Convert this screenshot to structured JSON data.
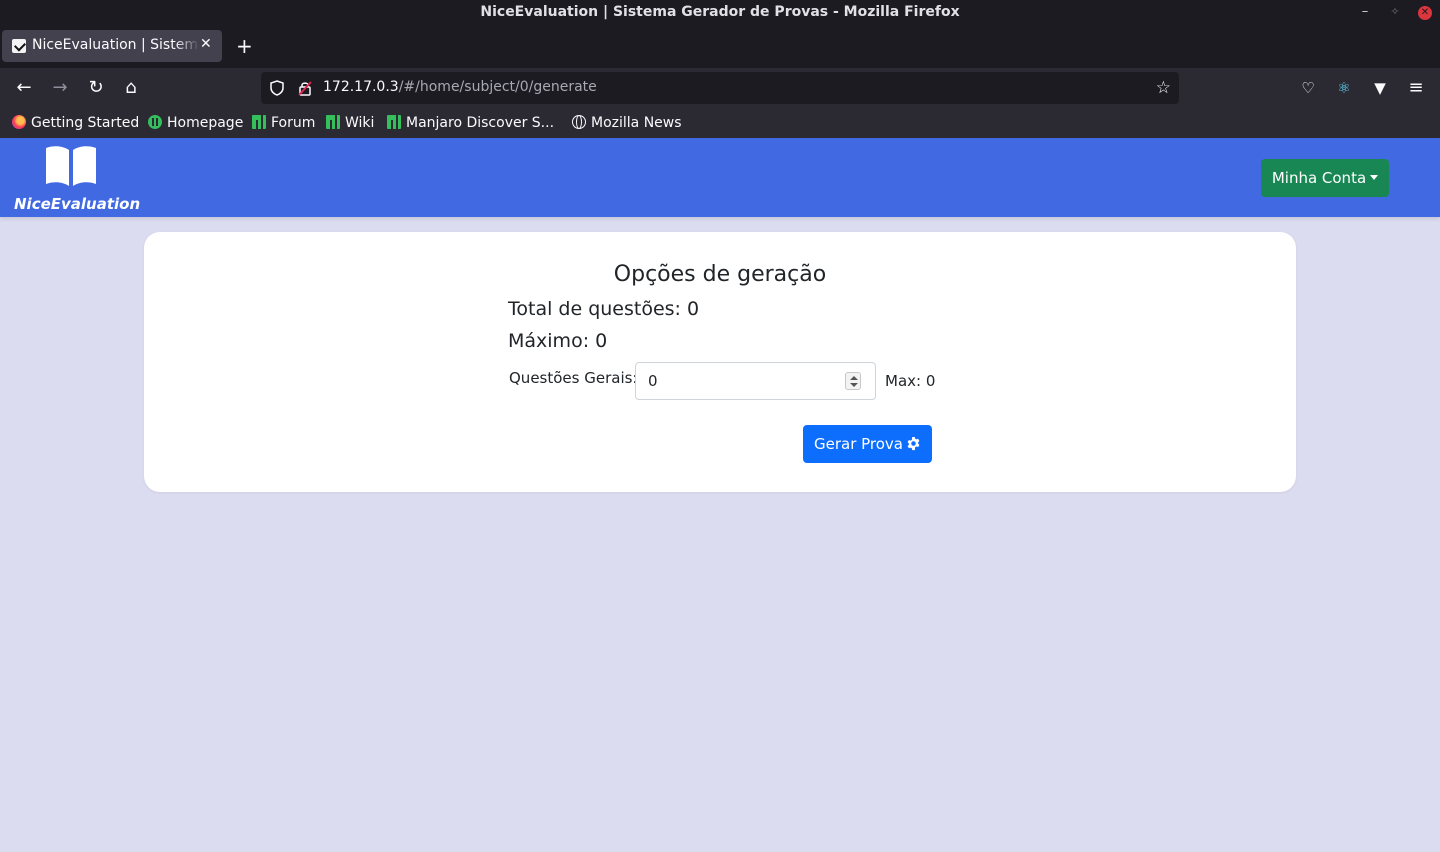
{
  "window": {
    "title": "NiceEvaluation | Sistema Gerador de Provas - Mozilla Firefox",
    "minimize": "–",
    "maximize": "✧",
    "close": "✕"
  },
  "tab": {
    "title": "NiceEvaluation | Sistema Gerador de Provas",
    "close": "✕",
    "new_tab": "+"
  },
  "nav": {
    "back": "←",
    "forward": "→",
    "reload": "↻",
    "home": "⌂",
    "url_host": "172.17.0.3",
    "url_path": "/#/home/subject/0/generate",
    "bookmark_star": "☆",
    "pocket": "♡",
    "react_devtools": "⚛",
    "vpn": "▼",
    "menu": "≡"
  },
  "bookmarks": [
    {
      "label": "Getting Started",
      "icon": "firefox-icon"
    },
    {
      "label": "Homepage",
      "icon": "manjaro-circle-icon"
    },
    {
      "label": "Forum",
      "icon": "manjaro-icon"
    },
    {
      "label": "Wiki",
      "icon": "manjaro-icon"
    },
    {
      "label": "Manjaro Discover S...",
      "icon": "manjaro-icon"
    },
    {
      "label": "Mozilla News",
      "icon": "globe-icon"
    }
  ],
  "header": {
    "brand": "NiceEvaluation",
    "logo_icon": "book-icon",
    "account_button": "Minha Conta",
    "header_color": "#4169e1",
    "account_color": "#198754"
  },
  "generation": {
    "title": "Opções de geração",
    "total_label": "Total de questões: 0",
    "max_label": "Máximo: 0",
    "field_label": "Questões Gerais:",
    "field_value": "0",
    "field_max": "Max: 0",
    "generate_button": "Gerar Prova",
    "generate_icon": "gear-icon",
    "button_color": "#0d6efd"
  }
}
